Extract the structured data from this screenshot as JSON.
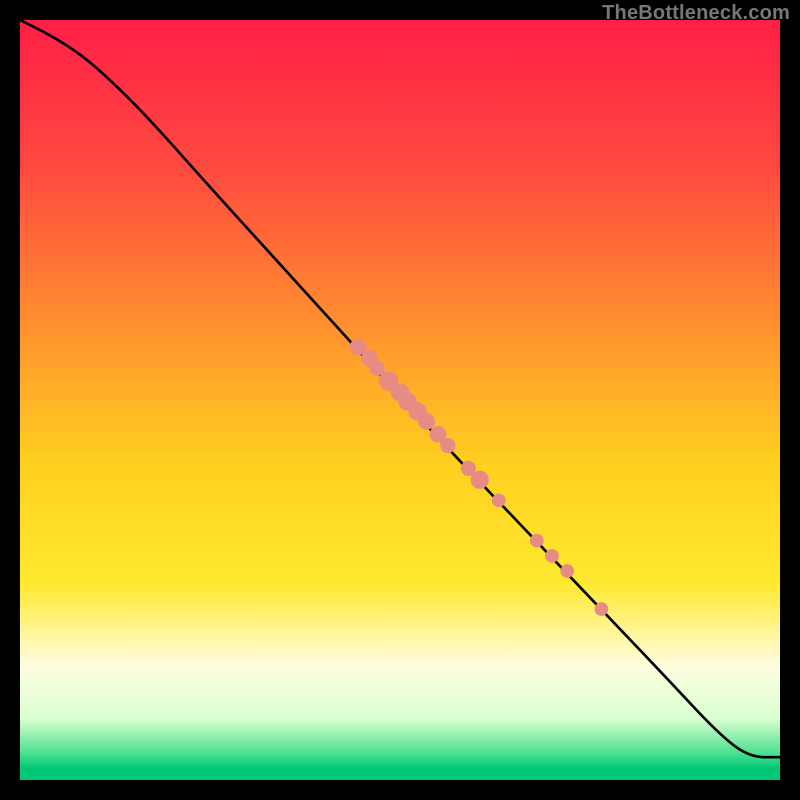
{
  "watermark": "TheBottleneck.com",
  "colors": {
    "frame": "#000000",
    "curve": "#000000",
    "dots": "#e78b85",
    "gradient_stops": [
      {
        "offset": 0.0,
        "color": "#ff1f47"
      },
      {
        "offset": 0.2,
        "color": "#ff4b3f"
      },
      {
        "offset": 0.4,
        "color": "#ff8f2e"
      },
      {
        "offset": 0.58,
        "color": "#ffcf1f"
      },
      {
        "offset": 0.74,
        "color": "#ffe92e"
      },
      {
        "offset": 0.85,
        "color": "#fffde0"
      },
      {
        "offset": 0.92,
        "color": "#d8ffd0"
      },
      {
        "offset": 0.965,
        "color": "#4be08e"
      },
      {
        "offset": 0.985,
        "color": "#00c878"
      },
      {
        "offset": 1.0,
        "color": "#00c878"
      }
    ]
  },
  "chart_data": {
    "type": "line",
    "title": "",
    "xlabel": "",
    "ylabel": "",
    "xlim": [
      0,
      100
    ],
    "ylim": [
      0,
      100
    ],
    "series": [
      {
        "name": "curve",
        "x": [
          0,
          4,
          8,
          12,
          17,
          25,
          35,
          45,
          55,
          65,
          75,
          85,
          92,
          96,
          100
        ],
        "y": [
          100,
          98,
          95.5,
          92,
          87,
          78,
          67,
          56,
          45,
          34.5,
          24,
          13.5,
          6,
          3,
          3
        ]
      }
    ],
    "scatter": {
      "name": "dots",
      "points": [
        {
          "x": 44.5,
          "y": 57,
          "r": 1.1
        },
        {
          "x": 46.0,
          "y": 55.5,
          "r": 1.1
        },
        {
          "x": 47.0,
          "y": 54.2,
          "r": 1.0
        },
        {
          "x": 48.5,
          "y": 52.5,
          "r": 1.3
        },
        {
          "x": 50.0,
          "y": 51.0,
          "r": 1.2
        },
        {
          "x": 51.0,
          "y": 49.8,
          "r": 1.2
        },
        {
          "x": 52.3,
          "y": 48.5,
          "r": 1.2
        },
        {
          "x": 53.5,
          "y": 47.2,
          "r": 1.1
        },
        {
          "x": 55.0,
          "y": 45.5,
          "r": 1.1
        },
        {
          "x": 56.3,
          "y": 44.0,
          "r": 1.0
        },
        {
          "x": 59.0,
          "y": 41.0,
          "r": 1.0
        },
        {
          "x": 60.5,
          "y": 39.5,
          "r": 1.2
        },
        {
          "x": 63.0,
          "y": 36.8,
          "r": 0.9
        },
        {
          "x": 68.0,
          "y": 31.5,
          "r": 0.9
        },
        {
          "x": 70.0,
          "y": 29.5,
          "r": 0.9
        },
        {
          "x": 72.0,
          "y": 27.5,
          "r": 0.9
        },
        {
          "x": 76.5,
          "y": 22.5,
          "r": 0.9
        }
      ]
    }
  }
}
